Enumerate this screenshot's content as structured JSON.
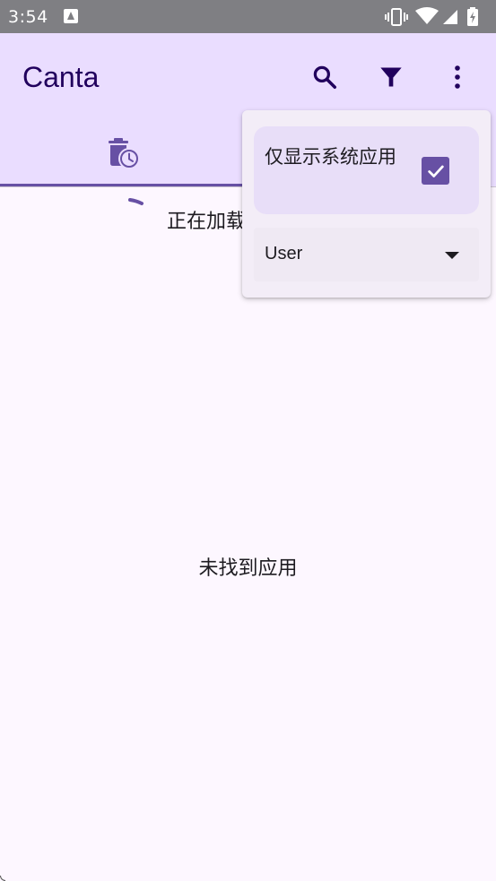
{
  "status_bar": {
    "time": "3:54",
    "icons": [
      "notification-a-icon",
      "vibrate-icon",
      "wifi-icon",
      "signal-icon",
      "battery-icon"
    ]
  },
  "app_bar": {
    "title": "Canta",
    "actions": [
      "search-icon",
      "filter-icon",
      "more-vert-icon"
    ],
    "background": "#eaddff",
    "title_color": "#21005d"
  },
  "tabs": {
    "items": [
      {
        "icon": "uninstalled-history-icon",
        "selected": true
      }
    ],
    "indicator_color": "#6750a4"
  },
  "content": {
    "loading_text": "正在加载",
    "empty_text": "未找到应用"
  },
  "filter_menu": {
    "system_apps_label": "仅显示系统应用",
    "system_apps_checked": true,
    "dropdown_value": "User",
    "accent": "#6750a4"
  }
}
